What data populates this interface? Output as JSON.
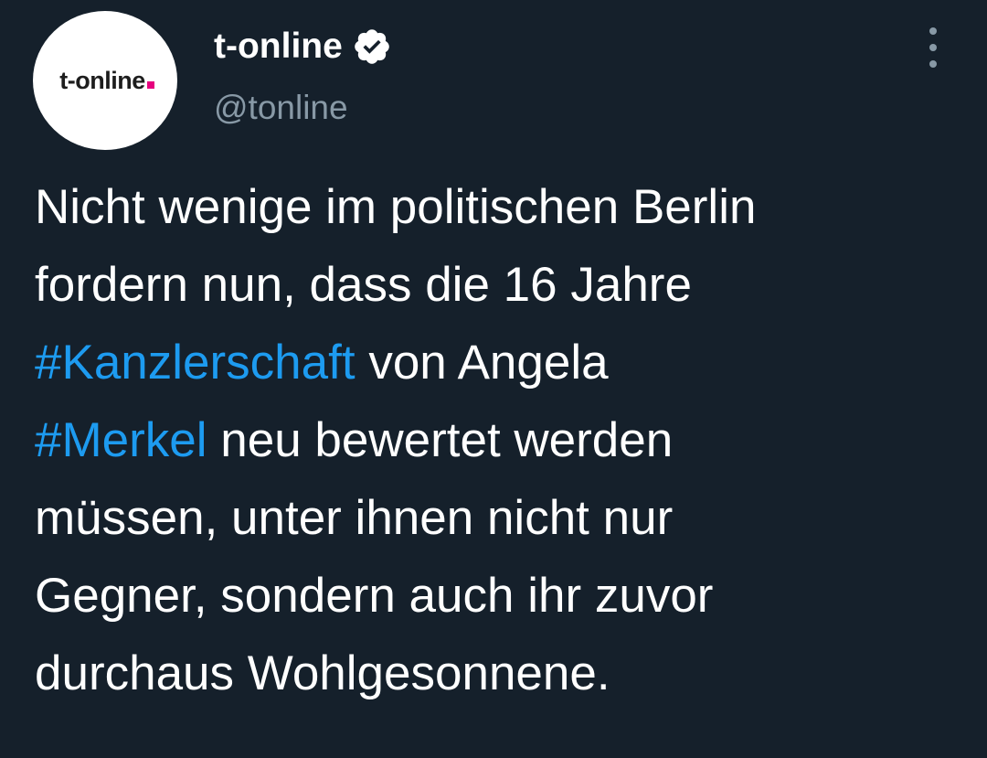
{
  "account": {
    "display_name": "t-online",
    "handle": "@tonline",
    "avatar_logo_text": "t-online",
    "verified": true
  },
  "tweet": {
    "segments": {
      "l1": "Nicht wenige im politischen Berlin",
      "l2": "fordern nun, dass die 16 Jahre",
      "l3_tag": "#Kanzlerschaft",
      "l3_rest": " von Angela",
      "l4_tag": "#Merkel",
      "l4_rest": " neu bewertet werden",
      "l5": "müssen, unter ihnen nicht nur",
      "l6": "Gegner, sondern auch ihr zuvor",
      "l7": "durchaus Wohlgesonnene."
    },
    "hashtags": [
      "#Kanzlerschaft",
      "#Merkel"
    ]
  },
  "colors": {
    "background": "#15202b",
    "text": "#ffffff",
    "secondary": "#8899a6",
    "link": "#1d9bf0",
    "logo_accent": "#e6007e"
  },
  "icons": {
    "verified": "verified-badge-icon",
    "more": "more-options-icon"
  }
}
